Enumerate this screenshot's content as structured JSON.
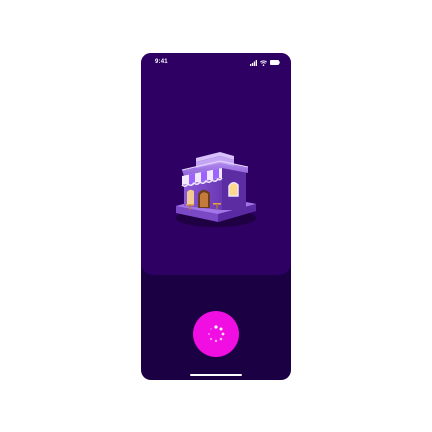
{
  "status_bar": {
    "time": "9:41",
    "icons": [
      "signal-icon",
      "wifi-icon",
      "battery-icon"
    ]
  },
  "illustration": {
    "icon": "store-icon"
  },
  "loading_button": {
    "icon": "spinner-icon"
  },
  "colors": {
    "page_background": "#ffffff",
    "phone_background": "#1b0044",
    "top_panel": "#2e0063",
    "accent": "#f00ee2"
  }
}
